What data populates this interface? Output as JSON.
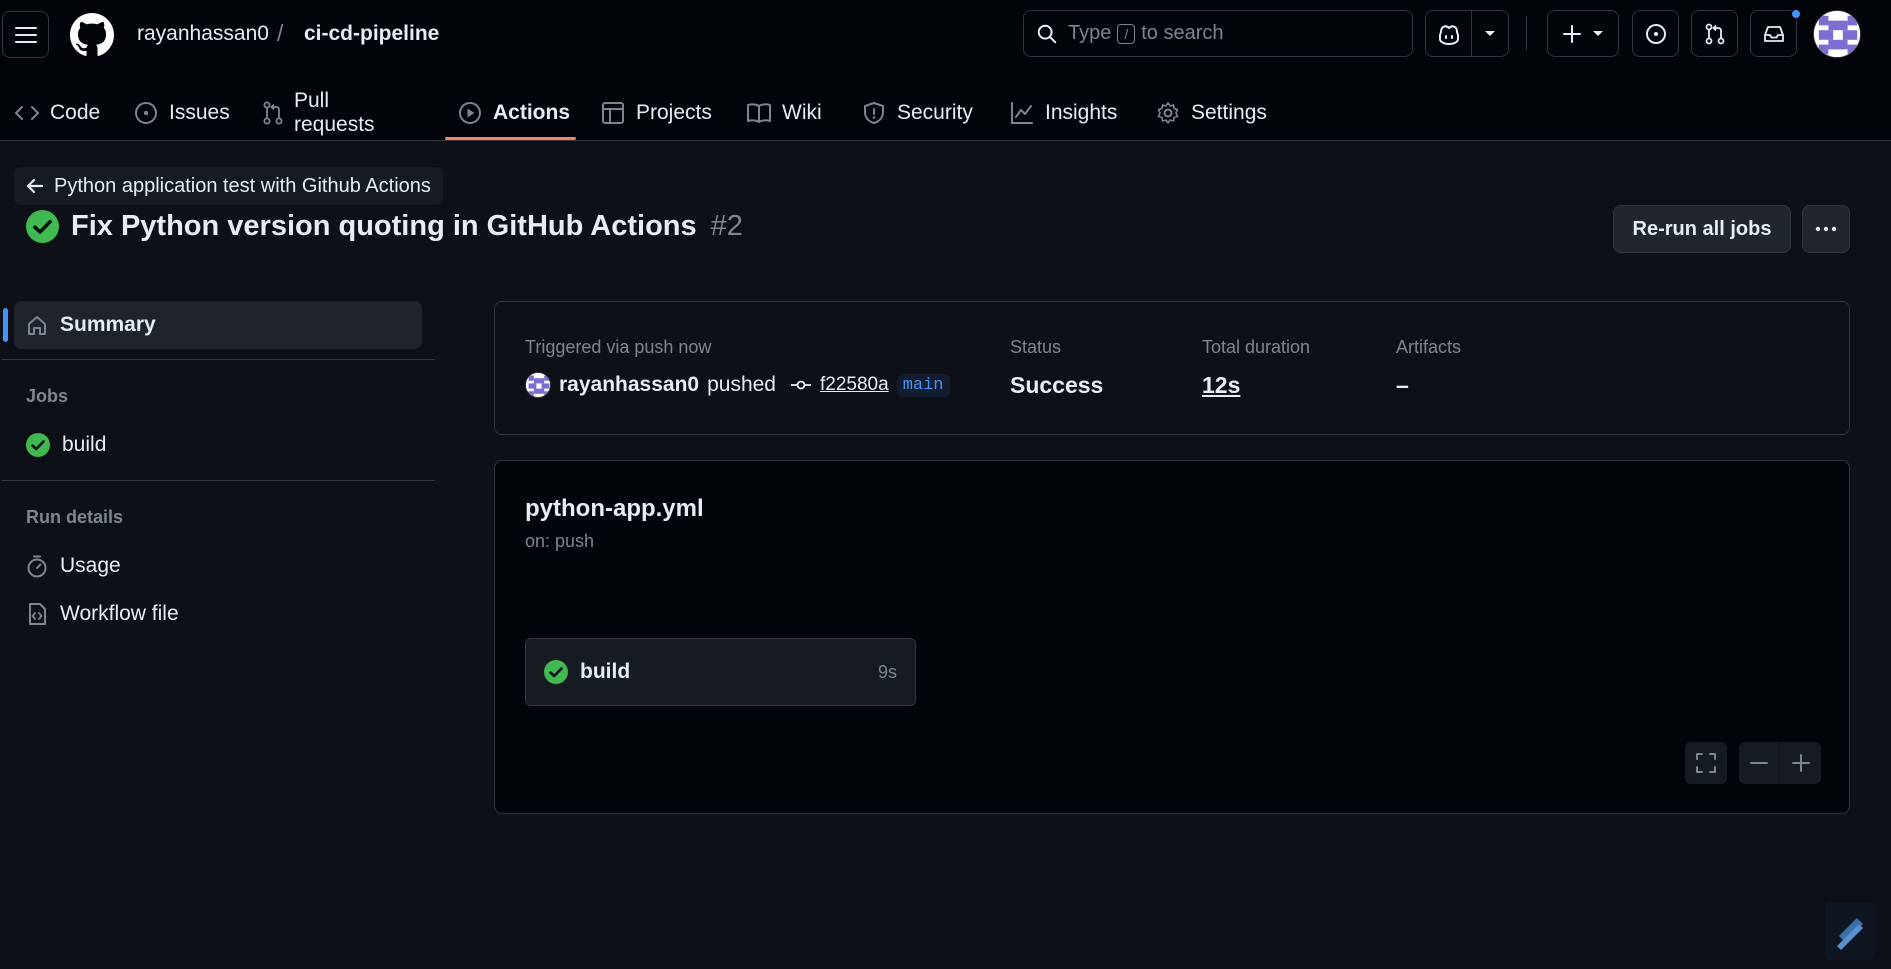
{
  "header": {
    "owner": "rayanhassan0",
    "separator": "/",
    "repo": "ci-cd-pipeline",
    "search_prefix": "Type",
    "search_key": "/",
    "search_suffix": "to search"
  },
  "tabs": [
    {
      "label": "Code",
      "icon": "code-icon"
    },
    {
      "label": "Issues",
      "icon": "issue-opened-icon"
    },
    {
      "label": "Pull requests",
      "icon": "git-pull-request-icon"
    },
    {
      "label": "Actions",
      "icon": "play-icon",
      "active": true
    },
    {
      "label": "Projects",
      "icon": "table-icon"
    },
    {
      "label": "Wiki",
      "icon": "book-icon"
    },
    {
      "label": "Security",
      "icon": "shield-icon"
    },
    {
      "label": "Insights",
      "icon": "graph-icon"
    },
    {
      "label": "Settings",
      "icon": "gear-icon"
    }
  ],
  "run": {
    "back_label": "Python application test with Github Actions",
    "title": "Fix Python version quoting in GitHub Actions",
    "number": "#2",
    "rerun_label": "Re-run all jobs"
  },
  "sidebar": {
    "summary_label": "Summary",
    "jobs_heading": "Jobs",
    "jobs": [
      {
        "label": "build"
      }
    ],
    "run_details_heading": "Run details",
    "usage_label": "Usage",
    "workflow_file_label": "Workflow file"
  },
  "summary": {
    "trigger_label": "Triggered via push now",
    "actor": "rayanhassan0",
    "action": "pushed",
    "commit_sha": "f22580a",
    "branch": "main",
    "status_label": "Status",
    "status_value": "Success",
    "duration_label": "Total duration",
    "duration_value": "12s",
    "artifacts_label": "Artifacts",
    "artifacts_value": "–"
  },
  "graph": {
    "workflow_file": "python-app.yml",
    "trigger": "on: push",
    "job_name": "build",
    "job_duration": "9s"
  },
  "colors": {
    "success": "#3fb950",
    "accent_underline": "#f78166",
    "link_blue": "#4493f8",
    "background": "#0d1117"
  }
}
